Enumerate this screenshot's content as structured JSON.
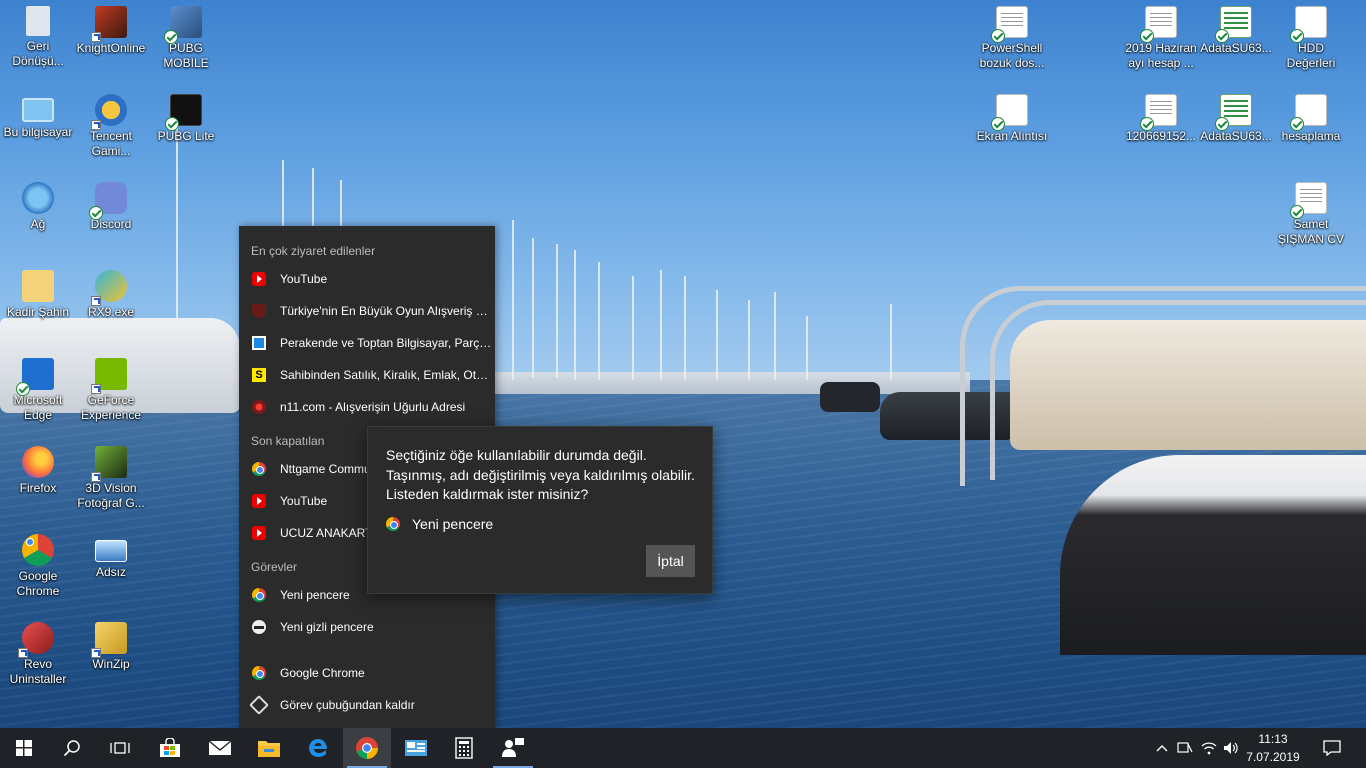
{
  "desktop": {
    "icons": [
      {
        "label": "Geri Dönüşü...",
        "icon": "recycle-bin-icon"
      },
      {
        "label": "KnightOnline",
        "icon": "knight-online-icon"
      },
      {
        "label": "PUBG MOBILE",
        "icon": "pubg-mobile-icon"
      },
      {
        "label": "Bu bilgisayar",
        "icon": "this-pc-icon"
      },
      {
        "label": "Tencent Gami...",
        "icon": "tencent-gaming-icon"
      },
      {
        "label": "PUBG Lite",
        "icon": "pubg-lite-icon"
      },
      {
        "label": "Ağ",
        "icon": "network-icon"
      },
      {
        "label": "Discord",
        "icon": "discord-icon"
      },
      {
        "label": "Kadir Şahin",
        "icon": "user-folder-icon"
      },
      {
        "label": "RX9.exe",
        "icon": "exe-icon"
      },
      {
        "label": "Microsoft Edge",
        "icon": "edge-icon"
      },
      {
        "label": "GeForce Experience",
        "icon": "geforce-icon"
      },
      {
        "label": "Firefox",
        "icon": "firefox-icon"
      },
      {
        "label": "3D Vision Fotoğraf G...",
        "icon": "3d-vision-icon"
      },
      {
        "label": "Google Chrome",
        "icon": "chrome-icon"
      },
      {
        "label": "Adsız",
        "icon": "image-file-icon"
      },
      {
        "label": "Revo Uninstaller",
        "icon": "revo-icon"
      },
      {
        "label": "WinZip",
        "icon": "winzip-icon"
      },
      {
        "label": "PowerShell bozuk dos...",
        "icon": "document-icon"
      },
      {
        "label": "2019 Haziran ayı hesap ...",
        "icon": "document-icon"
      },
      {
        "label": "AdataSU63...",
        "icon": "spreadsheet-icon"
      },
      {
        "label": "HDD Değerleri",
        "icon": "screenshot-file-icon"
      },
      {
        "label": "Ekran Alıntısı",
        "icon": "screenshot-file-icon"
      },
      {
        "label": "120669152...",
        "icon": "document-icon"
      },
      {
        "label": "AdataSU63...",
        "icon": "spreadsheet-icon"
      },
      {
        "label": "hesaplama",
        "icon": "screenshot-file-icon"
      },
      {
        "label": "Samet ŞIŞMAN CV",
        "icon": "document-icon"
      }
    ]
  },
  "jumplist": {
    "most_visited_title": "En çok ziyaret edilenler",
    "most_visited": [
      {
        "label": "YouTube",
        "icon": "youtube-icon"
      },
      {
        "label": "Türkiye'nin En Büyük Oyun Alışveriş Sit...",
        "icon": "shield-icon"
      },
      {
        "label": "Perakende ve Toptan Bilgisayar, Parça...",
        "icon": "store-icon"
      },
      {
        "label": "Sahibinden Satılık, Kiralık, Emlak, Oto,...",
        "icon": "sahibinden-icon"
      },
      {
        "label": "n11.com - Alışverişin Uğurlu Adresi",
        "icon": "n11-icon"
      }
    ],
    "recently_closed_title": "Son kapatılan",
    "recently_closed": [
      {
        "label": "Nttgame Commu",
        "icon": "chrome-icon"
      },
      {
        "label": "YouTube",
        "icon": "youtube-icon"
      },
      {
        "label": "UCUZ ANAKART",
        "icon": "youtube-icon"
      }
    ],
    "tasks_title": "Görevler",
    "tasks": [
      {
        "label": "Yeni pencere",
        "icon": "chrome-icon"
      },
      {
        "label": "Yeni gizli pencere",
        "icon": "incognito-icon"
      }
    ],
    "app_label": "Google Chrome",
    "unpin_label": "Görev çubuğundan kaldır",
    "s_glyph": "S"
  },
  "dialog": {
    "message": "Seçtiğiniz öğe kullanılabilir durumda değil. Taşınmış, adı değiştirilmiş veya kaldırılmış olabilir. Listeden kaldırmak ister misiniz?",
    "link_label": "Yeni pencere",
    "cancel_label": "İptal"
  },
  "taskbar": {
    "items": [
      "start-icon",
      "search-icon",
      "task-view-icon",
      "store-icon",
      "mail-icon",
      "file-explorer-icon",
      "edge-icon",
      "chrome-icon",
      "control-panel-icon",
      "calculator-icon",
      "people-icon"
    ],
    "active": "chrome-icon",
    "clock_time": "11:13",
    "clock_date": "7.07.2019"
  }
}
